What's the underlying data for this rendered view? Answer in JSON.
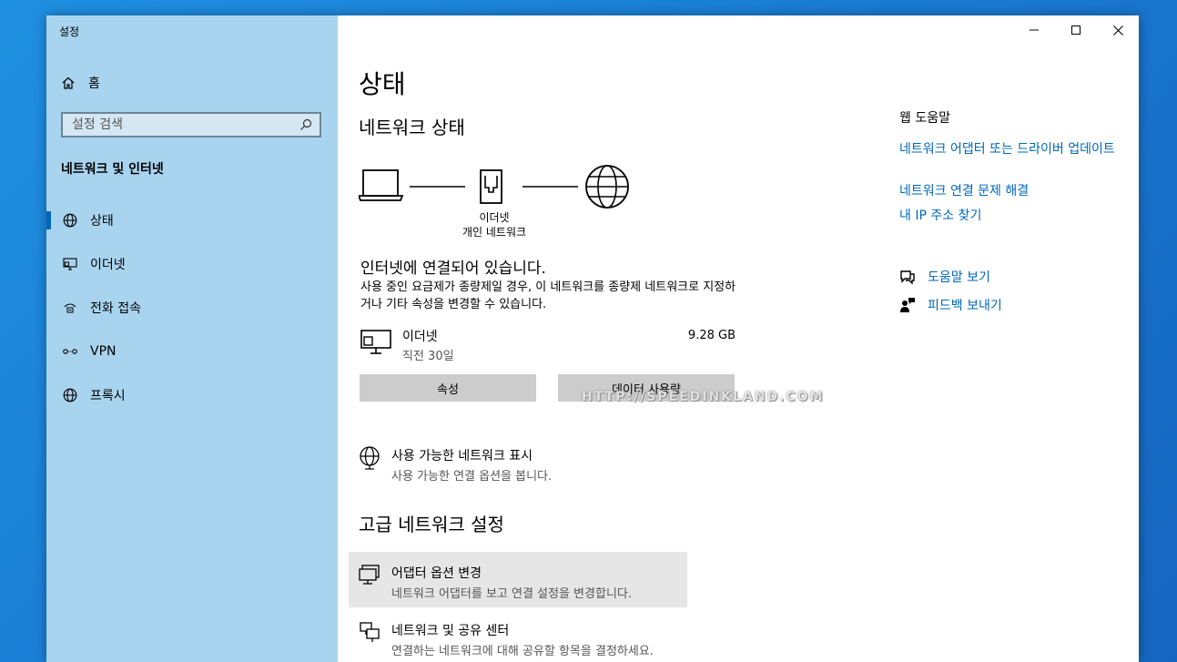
{
  "window": {
    "app_title": "설정",
    "controls": {
      "minimize": "—",
      "maximize": "☐",
      "close": "✕"
    }
  },
  "sidebar": {
    "home_label": "홈",
    "search_placeholder": "설정 검색",
    "section_title": "네트워크 및 인터넷",
    "items": [
      {
        "label": "상태",
        "icon": "globe-icon",
        "active": true
      },
      {
        "label": "이더넷",
        "icon": "ethernet-icon",
        "active": false
      },
      {
        "label": "전화 접속",
        "icon": "dialup-icon",
        "active": false
      },
      {
        "label": "VPN",
        "icon": "vpn-icon",
        "active": false
      },
      {
        "label": "프록시",
        "icon": "globe-icon",
        "active": false
      }
    ]
  },
  "main": {
    "title": "상태",
    "network_status_heading": "네트워크 상태",
    "diagram": {
      "line1": "이더넷",
      "line2": "개인 네트워크"
    },
    "connected_text": "인터넷에 연결되어 있습니다.",
    "description": "사용 중인 요금제가 종량제일 경우, 이 네트워크를 종량제 네트워크로 지정하거나 기타 속성을 변경할 수 있습니다.",
    "ethernet": {
      "name": "이더넷",
      "period": "직전 30일",
      "usage": "9.28 GB"
    },
    "buttons": {
      "properties": "속성",
      "data_usage": "데이터 사용량"
    },
    "watermark": "HTTP://SPEEDINKLAND.COM",
    "available_networks": {
      "title": "사용 가능한 네트워크 표시",
      "subtitle": "사용 가능한 연결 옵션을 봅니다."
    },
    "advanced_heading": "고급 네트워크 설정",
    "adapter_options": {
      "title": "어댑터 옵션 변경",
      "subtitle": "네트워크 어댑터를 보고 연결 설정을 변경합니다."
    },
    "sharing_center": {
      "title": "네트워크 및 공유 센터",
      "subtitle": "연결하는 네트워크에 대해 공유할 항목을 결정하세요."
    }
  },
  "help": {
    "title": "웹 도움말",
    "links": [
      "네트워크 어댑터 또는 드라이버 업데이트",
      "네트워크 연결 문제 해결",
      "내 IP 주소 찾기"
    ],
    "get_help": "도움말 보기",
    "feedback": "피드백 보내기"
  }
}
